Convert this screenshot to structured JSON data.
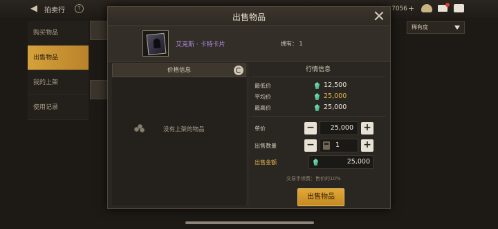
{
  "topbar": {
    "title": "拍卖行",
    "currency_value": "7056"
  },
  "sidebar": {
    "items": [
      {
        "label": "购买物品"
      },
      {
        "label": "出售物品"
      },
      {
        "label": "我的上架"
      },
      {
        "label": "使用记录"
      }
    ]
  },
  "filter": {
    "selected": "稀有度"
  },
  "modal": {
    "title": "出售物品",
    "item": {
      "name": "艾克斯 · 卡特卡片",
      "owned_label": "拥有：",
      "owned_value": "1"
    },
    "price_info": {
      "header": "价格信息",
      "empty_text": "没有上架的物品"
    },
    "market": {
      "title": "行情信息",
      "rows": [
        {
          "label": "最低价",
          "value": "12,500"
        },
        {
          "label": "平均价",
          "value": "25,000"
        },
        {
          "label": "最高价",
          "value": "25,000"
        }
      ]
    },
    "form": {
      "unit_price_label": "单价",
      "unit_price_value": "25,000",
      "quantity_label": "出售数量",
      "quantity_value": "1",
      "total_label": "出售金额",
      "total_value": "25,000",
      "minus": "−",
      "plus": "+"
    },
    "fee_text": "交易手续费：售价的10%",
    "sell_button": "出售物品"
  },
  "colors": {
    "accent_gold": "#e2b651",
    "item_name": "#a98be0",
    "gem": "#2f9e74"
  }
}
